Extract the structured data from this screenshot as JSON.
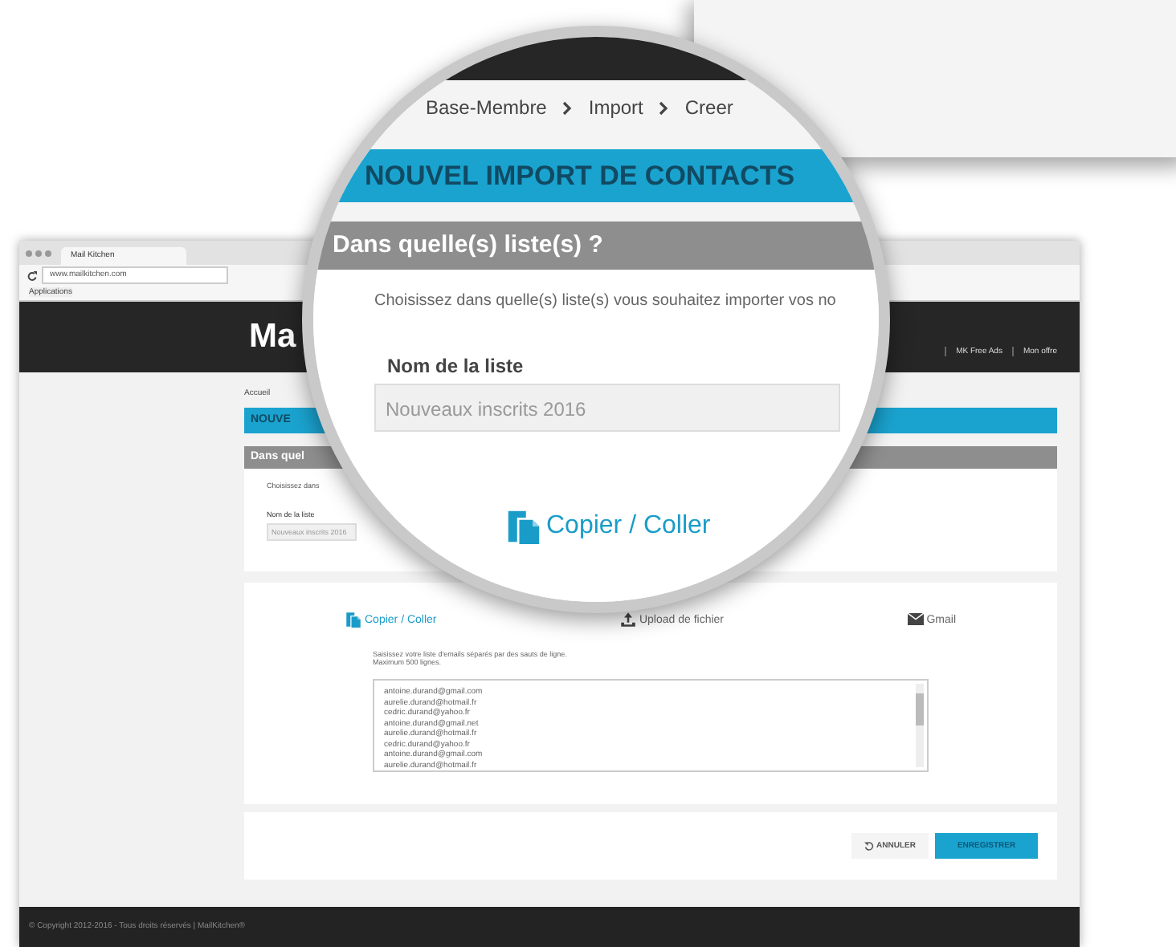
{
  "browser": {
    "tab_title": "Mail Kitchen",
    "url": "www.mailkitchen.com",
    "bookmark": "Applications",
    "logo": "Ma",
    "nav": [
      {
        "label": "MK Free Ads"
      },
      {
        "label": "Mon offre"
      }
    ],
    "breadcrumb": [
      {
        "label": "Accueil"
      }
    ],
    "header": "NOUVE",
    "section_title": "Dans quel",
    "intro": "Choisissez dans",
    "field_label": "Nom de la liste",
    "field_value": "Nouveaux inscrits 2016",
    "import_tabs": [
      {
        "label": "Copier / Coller",
        "kind": "clipboard",
        "selected": true
      },
      {
        "label": "Upload de fichier",
        "kind": "upload",
        "selected": false
      },
      {
        "label": "Gmail",
        "kind": "mail",
        "selected": false
      }
    ],
    "instructions": [
      "Saisissez votre liste d'emails séparés par des sauts de ligne.",
      "Maximum 500 lignes."
    ],
    "emails": [
      "antoine.durand@gmail.com",
      "aurelie.durand@hotmail.fr",
      "cedric.durand@yahoo.fr",
      "antoine.durand@gmail.net",
      "aurelie.durand@hotmail.fr",
      "cedric.durand@yahoo.fr",
      "antoine.durand@gmail.com",
      "aurelie.durand@hotmail.fr"
    ],
    "buttons": [
      {
        "label": "ANNULER",
        "kind": "secondary"
      },
      {
        "label": "ENREGISTRER",
        "kind": "primary"
      }
    ],
    "footer": "© Copyright 2012-2016 - Tous droits réservés | MailKitchen®"
  },
  "magnifier": {
    "breadcrumb": [
      {
        "label": "Base-Membre"
      },
      {
        "label": "Import"
      },
      {
        "label": "Creer"
      }
    ],
    "header": "NOUVEL IMPORT DE CONTACTS",
    "section_title": "Dans quelle(s) liste(s) ?",
    "intro": "Choisissez dans quelle(s) liste(s) vous souhaitez importer vos no",
    "field_label": "Nom de la liste",
    "field_value": "Nouveaux inscrits 2016",
    "tab": {
      "label": "Copier / Coller",
      "kind": "clipboard"
    }
  }
}
